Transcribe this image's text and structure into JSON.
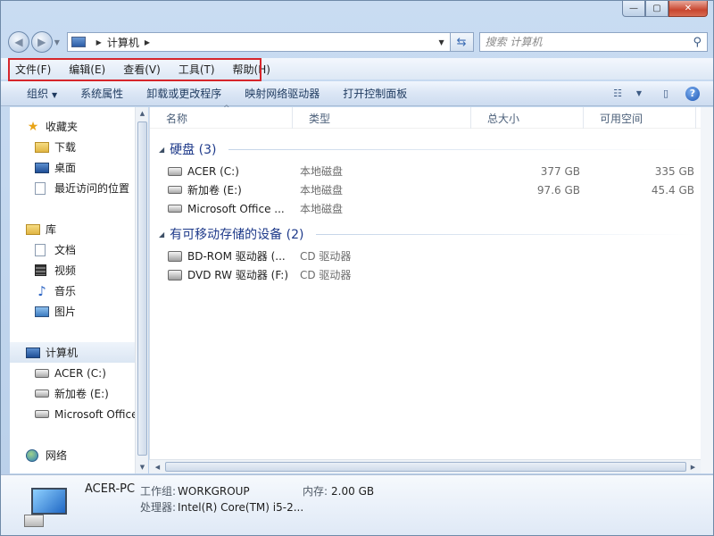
{
  "window": {
    "caption": {
      "min": "—",
      "max": "▢",
      "close": "✕"
    }
  },
  "nav": {
    "back": "◀",
    "forward": "▶",
    "address_crumbs": [
      "计算机"
    ],
    "search_placeholder": "搜索 计算机"
  },
  "menu": {
    "items": [
      "文件(F)",
      "编辑(E)",
      "查看(V)",
      "工具(T)",
      "帮助(H)"
    ]
  },
  "toolbar": {
    "organize": "组织",
    "items": [
      "系统属性",
      "卸载或更改程序",
      "映射网络驱动器",
      "打开控制面板"
    ],
    "help": "?"
  },
  "sidebar": {
    "favorites": {
      "label": "收藏夹",
      "items": [
        "下载",
        "桌面",
        "最近访问的位置"
      ]
    },
    "libraries": {
      "label": "库",
      "items": [
        "文档",
        "视频",
        "音乐",
        "图片"
      ]
    },
    "computer": {
      "label": "计算机",
      "items": [
        "ACER (C:)",
        "新加卷 (E:)",
        "Microsoft Office"
      ]
    },
    "network": {
      "label": "网络"
    }
  },
  "columns": [
    "名称",
    "类型",
    "总大小",
    "可用空间"
  ],
  "groups": [
    {
      "title": "硬盘 (3)",
      "rows": [
        {
          "name": "ACER (C:)",
          "type": "本地磁盘",
          "total": "377 GB",
          "free": "335 GB",
          "icon": "windows-drive-icon"
        },
        {
          "name": "新加卷 (E:)",
          "type": "本地磁盘",
          "total": "97.6 GB",
          "free": "45.4 GB",
          "icon": "drive-icon"
        },
        {
          "name": "Microsoft Office ...",
          "type": "本地磁盘",
          "total": "",
          "free": "",
          "icon": "drive-icon"
        }
      ]
    },
    {
      "title": "有可移动存储的设备 (2)",
      "rows": [
        {
          "name": "BD-ROM 驱动器 (...",
          "type": "CD 驱动器",
          "total": "",
          "free": "",
          "icon": "optical-drive-icon"
        },
        {
          "name": "DVD RW 驱动器 (F:)",
          "type": "CD 驱动器",
          "total": "",
          "free": "",
          "icon": "optical-drive-icon"
        }
      ]
    }
  ],
  "details": {
    "name": "ACER-PC",
    "workgroup_label": "工作组:",
    "workgroup": "WORKGROUP",
    "memory_label": "内存:",
    "memory": "2.00 GB",
    "cpu_label": "处理器:",
    "cpu": "Intel(R) Core(TM) i5-2..."
  }
}
